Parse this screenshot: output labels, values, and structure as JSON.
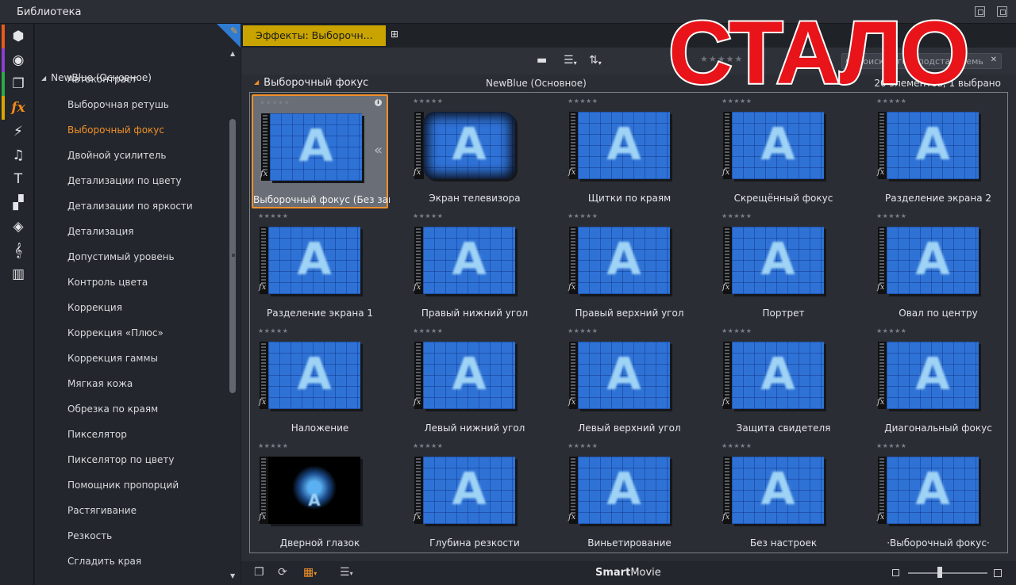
{
  "window": {
    "title": "Библиотека"
  },
  "rail": {
    "items": [
      {
        "icon": "package-icon",
        "glyph": "⬢",
        "color": "#e85a1a"
      },
      {
        "icon": "film-reel-icon",
        "glyph": "◉",
        "color": "#8a3fd1"
      },
      {
        "icon": "clips-icon",
        "glyph": "❐",
        "color": "#2fa84a"
      },
      {
        "icon": "fx-icon",
        "glyph": "fx",
        "color": "#d9a400",
        "active": true
      },
      {
        "icon": "lightning-icon",
        "glyph": "⚡",
        "color": ""
      },
      {
        "icon": "music-note-icon",
        "glyph": "♫",
        "color": ""
      },
      {
        "icon": "title-icon",
        "glyph": "T",
        "color": ""
      },
      {
        "icon": "transition-icon",
        "glyph": "▞",
        "color": ""
      },
      {
        "icon": "layers-icon",
        "glyph": "◈",
        "color": ""
      },
      {
        "icon": "treble-clef-icon",
        "glyph": "𝄞",
        "color": ""
      },
      {
        "icon": "piano-icon",
        "glyph": "▥",
        "color": ""
      }
    ]
  },
  "tree": {
    "group": "NewBlue (Основное)",
    "items": [
      "Автоконтраст",
      "Выборочная ретушь",
      "Выборочный фокус",
      "Двойной усилитель",
      "Детализации по цвету",
      "Детализации по яркости",
      "Детализация",
      "Допустимый уровень",
      "Контроль цвета",
      "Коррекция",
      "Коррекция «Плюс»",
      "Коррекция гаммы",
      "Мягкая кожа",
      "Обрезка по краям",
      "Пикселятор",
      "Пикселятор по цвету",
      "Помощник пропорций",
      "Растягивание",
      "Резкость",
      "Сгладить края"
    ],
    "selected_index": 2
  },
  "tabs": [
    {
      "label": "Эффекты: Выборочн..."
    }
  ],
  "search": {
    "placeholder": "Поиск тегов, подставляемых"
  },
  "path": {
    "section": "Выборочный фокус",
    "group": "NewBlue (Основное)",
    "count": "20 элементов, 1 выбрано"
  },
  "grid": {
    "items": [
      {
        "label": "Выборочный фокус (Без заг...",
        "style": "normal",
        "selected": true
      },
      {
        "label": "Экран телевизора",
        "style": "tv"
      },
      {
        "label": "Щитки по краям",
        "style": "normal"
      },
      {
        "label": "Скрещённый фокус",
        "style": "normal"
      },
      {
        "label": "Разделение экрана 2",
        "style": "normal"
      },
      {
        "label": "Разделение экрана 1",
        "style": "normal"
      },
      {
        "label": "Правый нижний угол",
        "style": "normal"
      },
      {
        "label": "Правый верхний угол",
        "style": "normal"
      },
      {
        "label": "Портрет",
        "style": "normal"
      },
      {
        "label": "Овал по центру",
        "style": "normal"
      },
      {
        "label": "Наложение",
        "style": "normal"
      },
      {
        "label": "Левый нижний угол",
        "style": "normal"
      },
      {
        "label": "Левый верхний угол",
        "style": "normal"
      },
      {
        "label": "Защита свидетеля",
        "style": "normal"
      },
      {
        "label": "Диагональный фокус",
        "style": "normal"
      },
      {
        "label": "Дверной глазок",
        "style": "peep"
      },
      {
        "label": "Глубина резкости",
        "style": "normal"
      },
      {
        "label": "Виньетирование",
        "style": "normal"
      },
      {
        "label": "Без настроек",
        "style": "normal"
      },
      {
        "label": "·Выборочный фокус·",
        "style": "normal"
      }
    ],
    "thumb_letter": "A",
    "fx_mark": "fx",
    "stars": "★★★★★"
  },
  "bottom": {
    "brand_bold": "Smart",
    "brand_rest": "Movie",
    "zoom": 0.4
  },
  "overlay": {
    "text": "СТАЛО",
    "color": "#e8141a"
  }
}
